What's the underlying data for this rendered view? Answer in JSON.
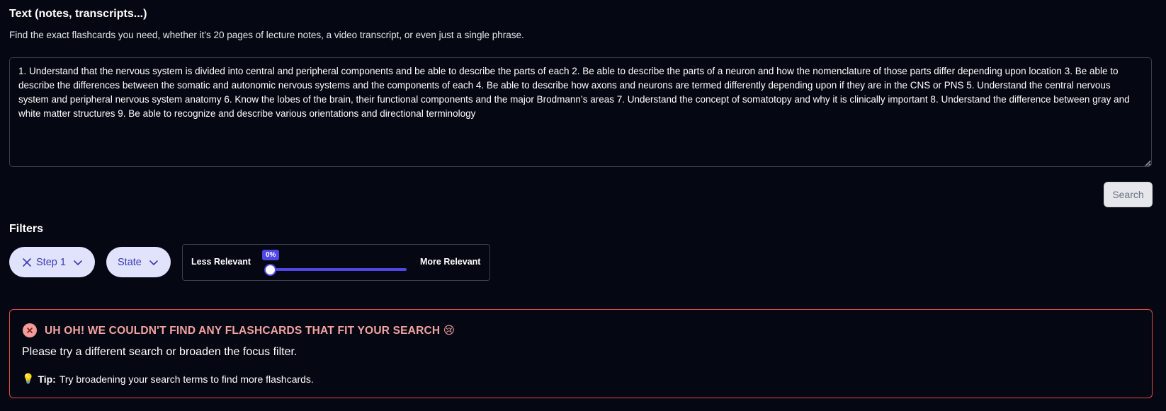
{
  "input_section": {
    "title": "Text (notes, transcripts...)",
    "description": "Find the exact flashcards you need, whether it's 20 pages of lecture notes, a video transcript, or even just a single phrase.",
    "text_value": "1. Understand that the nervous system is divided into central and peripheral components and be able to describe the parts of each 2. Be able to describe the parts of a neuron and how the nomenclature of those parts differ depending upon location 3. Be able to describe the differences between the somatic and autonomic nervous systems and the components of each 4. Be able to describe how axons and neurons are termed differently depending upon if they are in the CNS or PNS 5. Understand the central nervous system and peripheral nervous system anatomy 6. Know the lobes of the brain, their functional components and the major Brodmann’s areas 7. Understand the concept of somatotopy and why it is clinically important 8. Understand the difference between gray and white matter structures 9. Be able to recognize and describe various orientations and directional terminology",
    "search_label": "Search"
  },
  "filters": {
    "title": "Filters",
    "step_filter": {
      "label": "Step 1",
      "icons": [
        "close-icon",
        "chevron-down-icon"
      ]
    },
    "state_filter": {
      "label": "State",
      "icons": [
        "chevron-down-icon"
      ]
    },
    "relevance": {
      "less_label": "Less Relevant",
      "more_label": "More Relevant",
      "value_label": "0%",
      "value_fraction": 0
    }
  },
  "alert": {
    "icon": "error-circle-icon",
    "title": "UH OH! WE COULDN'T FIND ANY FLASHCARDS THAT FIT YOUR SEARCH 😢",
    "message": "Please try a different search or broaden the focus filter.",
    "tip_icon": "💡",
    "tip_label": "Tip:",
    "tip_text": "Try broadening your search terms to find more flashcards."
  },
  "colors": {
    "background": "#050812",
    "accent": "#4f46e5",
    "pill_bg": "#e0e3fb",
    "pill_text": "#3b39b8",
    "error_border": "#dc4b4b",
    "error_title": "#f4a3a3"
  }
}
